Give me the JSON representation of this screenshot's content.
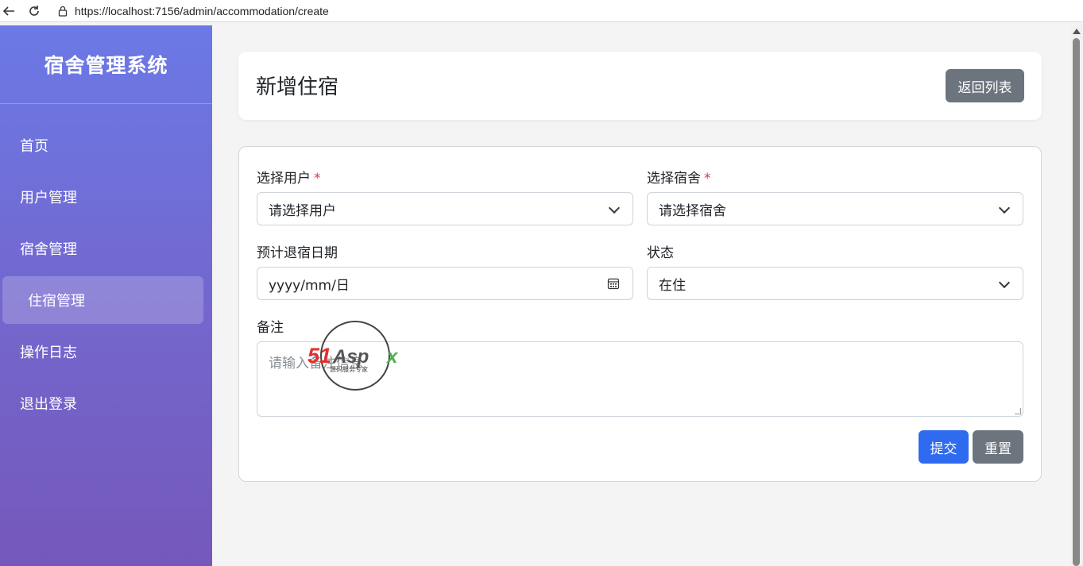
{
  "browser": {
    "url": "https://localhost:7156/admin/accommodation/create"
  },
  "sidebar": {
    "title": "宿舍管理系统",
    "items": [
      {
        "label": "首页"
      },
      {
        "label": "用户管理"
      },
      {
        "label": "宿舍管理"
      },
      {
        "label": "住宿管理"
      },
      {
        "label": "操作日志"
      },
      {
        "label": "退出登录"
      }
    ],
    "active_item": "住宿管理"
  },
  "header": {
    "title": "新增住宿",
    "back_label": "返回列表"
  },
  "form": {
    "user": {
      "label": "选择用户",
      "required_mark": "*",
      "value": "请选择用户"
    },
    "dorm": {
      "label": "选择宿舍",
      "required_mark": "*",
      "value": "请选择宿舍"
    },
    "checkout_date": {
      "label": "预计退宿日期",
      "value": "yyyy/mm/日"
    },
    "status": {
      "label": "状态",
      "value": "在住"
    },
    "remark": {
      "label": "备注",
      "placeholder": "请输入备注信息"
    },
    "submit_label": "提交",
    "reset_label": "重置"
  },
  "watermark": {
    "brand": "51Aspx",
    "tagline": "源码服务专家"
  },
  "colors": {
    "sidebar_top": "#6b79e6",
    "sidebar_bottom": "#7558bb",
    "primary": "#2f6bef",
    "secondary": "#6c757d",
    "required": "#dc3545"
  }
}
